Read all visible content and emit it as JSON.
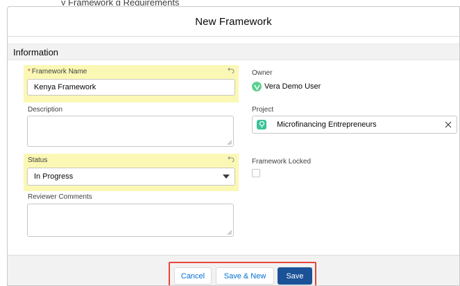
{
  "background": {
    "cut_text": "y Framework g Requirements"
  },
  "modal": {
    "title": "New Framework"
  },
  "section": {
    "title": "Information"
  },
  "fields": {
    "framework_name": {
      "required_marker": "*",
      "label": "Framework Name",
      "value": "Kenya Framework"
    },
    "description": {
      "label": "Description",
      "value": ""
    },
    "status": {
      "label": "Status",
      "value": "In Progress"
    },
    "reviewer_comments": {
      "label": "Reviewer Comments",
      "value": ""
    },
    "owner": {
      "label": "Owner",
      "value": "Vera Demo User"
    },
    "project": {
      "label": "Project",
      "value": "Microfinancing Entrepreneurs"
    },
    "framework_locked": {
      "label": "Framework Locked",
      "checked": false
    }
  },
  "footer": {
    "cancel_label": "Cancel",
    "save_new_label": "Save & New",
    "save_label": "Save"
  },
  "colors": {
    "highlight": "#fbf8b5",
    "brand": "#1b5297",
    "link": "#0070d2",
    "outline": "#e8453c",
    "avatar": "#5ccf8f",
    "project_icon": "#3cc29a"
  },
  "icons": {
    "undo": "undo-icon",
    "caret": "chevron-down-icon",
    "clear": "close-icon",
    "avatar": "user-avatar-icon",
    "project": "project-icon"
  }
}
